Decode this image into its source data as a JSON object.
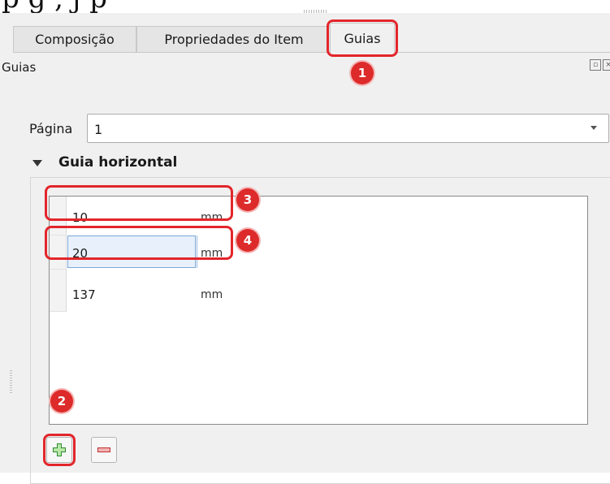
{
  "caption_fragment": "p        g        ,        j   p",
  "tabs": [
    {
      "label": "Composição",
      "active": false
    },
    {
      "label": "Propriedades do Item",
      "active": false
    },
    {
      "label": "Guias",
      "active": true
    }
  ],
  "dock": {
    "title": "Guias",
    "float_icon": "float-icon",
    "close_icon": "close-icon"
  },
  "page": {
    "label": "Página",
    "value": "1"
  },
  "group": {
    "title": "Guia horizontal",
    "toggle_icon": "triangle-down-icon"
  },
  "guides": [
    {
      "value": "10",
      "unit": "mm"
    },
    {
      "value": "20",
      "unit": "mm"
    },
    {
      "value": "137",
      "unit": "mm"
    }
  ],
  "buttons": {
    "add_icon": "plus-icon",
    "remove_icon": "minus-icon"
  },
  "annotations": [
    "1",
    "2",
    "3",
    "4"
  ],
  "colors": {
    "highlight": "#e3262b",
    "badge": "#dd2a2a",
    "panel": "#f0f0f0"
  }
}
